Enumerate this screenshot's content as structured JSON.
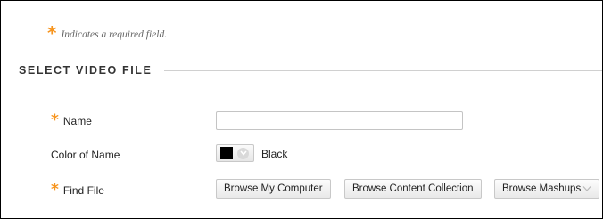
{
  "required_note": {
    "marker": "*",
    "text": "Indicates a required field."
  },
  "section": {
    "title": "SELECT VIDEO FILE"
  },
  "fields": {
    "name": {
      "marker": "*",
      "label": "Name",
      "value": ""
    },
    "color_of_name": {
      "label": "Color of Name",
      "swatch_color": "#000000",
      "value_label": "Black"
    },
    "find_file": {
      "marker": "*",
      "label": "Find File",
      "buttons": {
        "browse_computer": "Browse My Computer",
        "browse_collection": "Browse Content Collection",
        "browse_mashups": "Browse Mashups"
      }
    }
  },
  "icons": {
    "required": "asterisk",
    "picker": "chevron-down-icon",
    "mashups": "chevron-down-icon"
  },
  "colors": {
    "required_marker": "#f7941d",
    "section_rule": "#d0d0d0"
  }
}
